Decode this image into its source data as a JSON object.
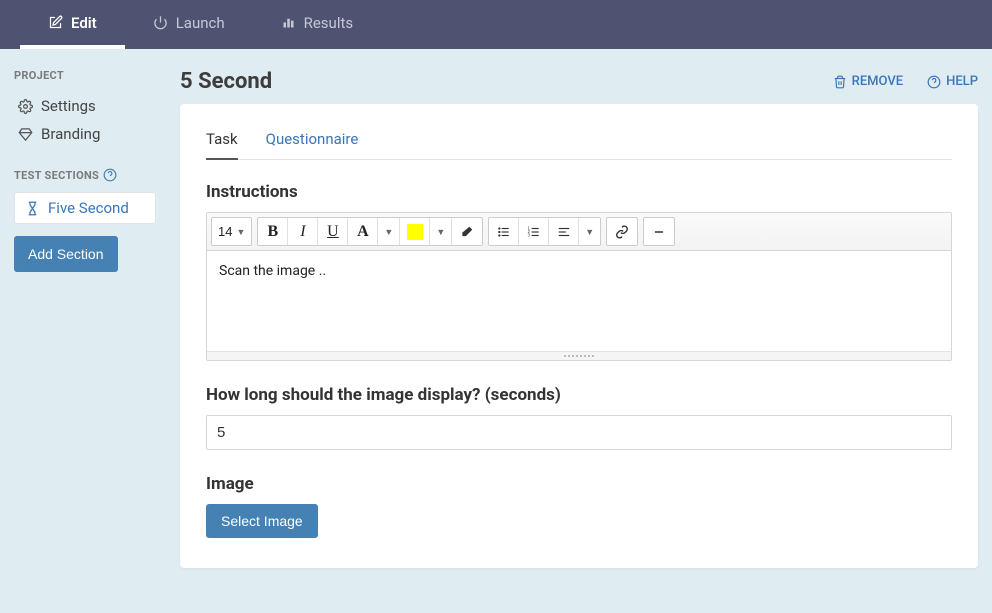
{
  "topnav": {
    "tabs": [
      {
        "label": "Edit",
        "active": true
      },
      {
        "label": "Launch"
      },
      {
        "label": "Results"
      }
    ]
  },
  "sidebar": {
    "project_heading": "PROJECT",
    "project_items": [
      {
        "label": "Settings"
      },
      {
        "label": "Branding"
      }
    ],
    "test_sections_heading": "TEST SECTIONS",
    "sections": [
      {
        "label": "Five Second"
      }
    ],
    "add_section_label": "Add Section"
  },
  "header": {
    "title": "5 Second",
    "remove_label": "REMOVE",
    "help_label": "HELP"
  },
  "card": {
    "tabs": [
      {
        "label": "Task",
        "active": true
      },
      {
        "label": "Questionnaire"
      }
    ],
    "instructions_label": "Instructions",
    "font_size": "14",
    "editor_content": "Scan the image ..",
    "duration_label": "How long should the image display? (seconds)",
    "duration_value": "5",
    "image_label": "Image",
    "select_image_label": "Select Image"
  }
}
